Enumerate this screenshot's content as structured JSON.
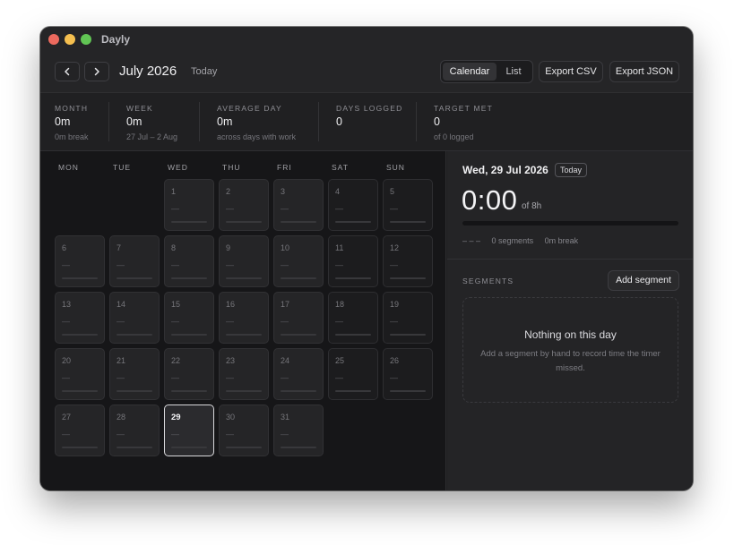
{
  "app": {
    "title": "Dayly"
  },
  "toolbar": {
    "month_title": "July 2026",
    "today_label": "Today",
    "views": [
      "Calendar",
      "List"
    ],
    "active_view": "Calendar",
    "export_csv": "Export CSV",
    "export_json": "Export JSON"
  },
  "stats": [
    {
      "label": "MONTH",
      "value": "0m",
      "sub": "0m break"
    },
    {
      "label": "WEEK",
      "value": "0m",
      "sub": "27 Jul – 2 Aug"
    },
    {
      "label": "AVERAGE DAY",
      "value": "0m",
      "sub": "across days with work"
    },
    {
      "label": "DAYS LOGGED",
      "value": "0",
      "sub": ""
    },
    {
      "label": "TARGET MET",
      "value": "0",
      "sub": "of 0 logged"
    }
  ],
  "calendar": {
    "weekdays": [
      "MON",
      "TUE",
      "WED",
      "THU",
      "FRI",
      "SAT",
      "SUN"
    ],
    "first_weekday_index": 2,
    "days_in_month": 31,
    "selected_day": 29,
    "empty_value": "—"
  },
  "panel": {
    "selected_date": "Wed, 29 Jul 2026",
    "today_badge": "Today",
    "total_time": "0:00",
    "target": "of 8h",
    "progress": 0,
    "range": "– – –",
    "segments_count": "0 segments",
    "break_total": "0m break",
    "segments_label": "SEGMENTS",
    "add_segment": "Add segment",
    "empty_title": "Nothing on this day",
    "empty_desc": "Add a segment by hand to record time the timer missed."
  },
  "colors": {
    "accent": "#d0d0d4",
    "background": "#1f1f21",
    "selected_border": "#d9d9dc"
  }
}
